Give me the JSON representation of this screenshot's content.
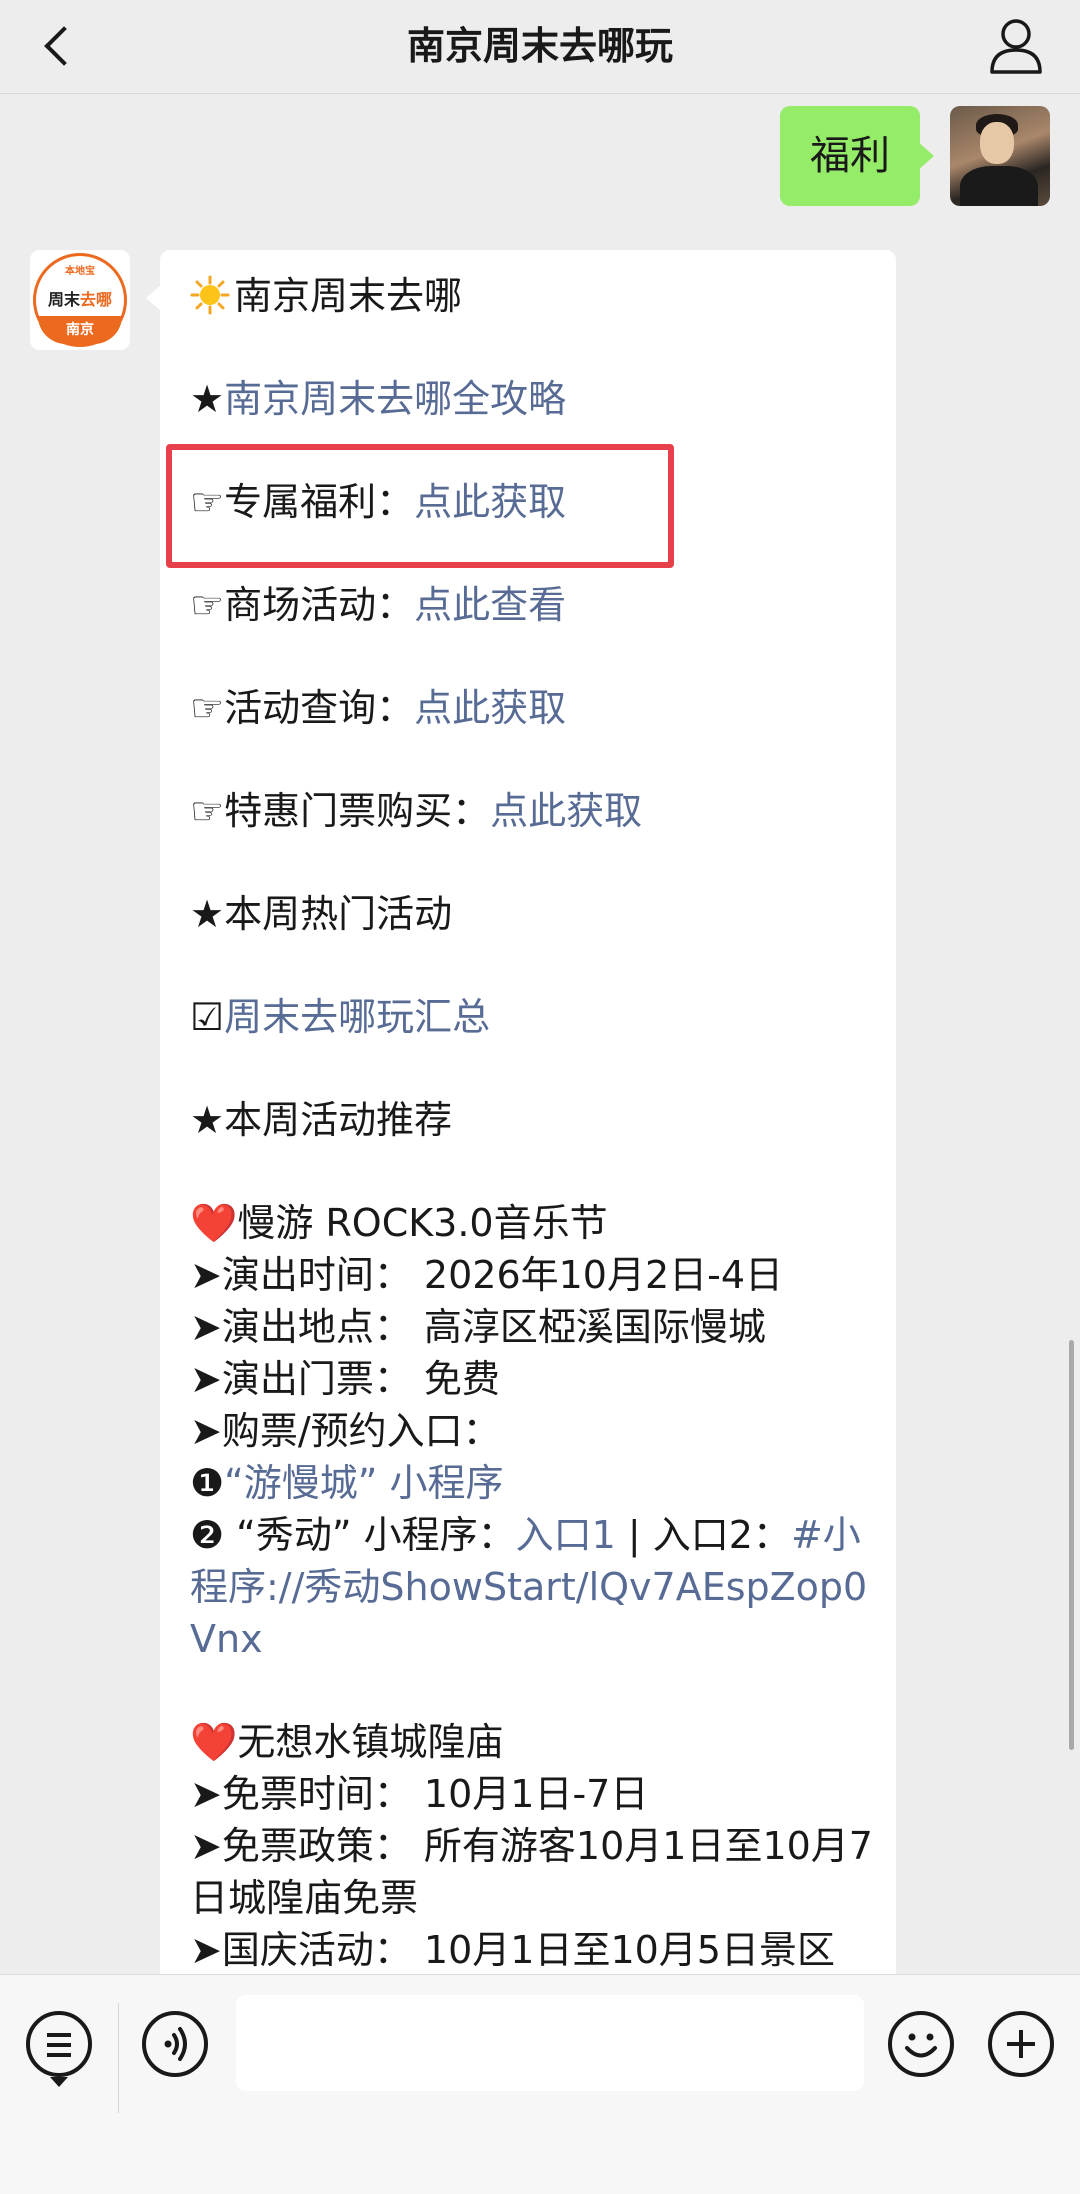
{
  "header": {
    "title": "南京周末去哪玩"
  },
  "outgoing": {
    "text": "福利"
  },
  "avatar_bot": {
    "top": "本地宝",
    "mid_a": "周末",
    "mid_b": "去哪",
    "bottom": "南京"
  },
  "message": {
    "brand": "南京周末去哪",
    "guide_star": "★",
    "guide_link": "南京周末去哪全攻略",
    "menu": [
      {
        "prefix": "☞专属福利：",
        "link": "点此获取"
      },
      {
        "prefix": "☞商场活动：",
        "link": "点此查看"
      },
      {
        "prefix": "☞活动查询：",
        "link": "点此获取"
      },
      {
        "prefix": "☞特惠门票购买：",
        "link": "点此获取"
      }
    ],
    "hot_title": "★本周热门活动",
    "summary_box": "☑",
    "summary_link": "周末去哪玩汇总",
    "rec_title": "★本周活动推荐",
    "event1": {
      "title": "❤️慢游 ROCK3.0音乐节",
      "time": "➤演出时间： 2026年10月2日-4日",
      "place": "➤演出地点： 高淳区椏溪国际慢城",
      "ticket": "➤演出门票： 免费",
      "entry": "➤购票/预约入口：",
      "mini1_num": "❶",
      "mini1_link": "“游慢城” 小程序",
      "mini2_prefix": "❷ “秀动” 小程序：",
      "mini2_link1": "入口1",
      "mini2_sep": " | 入口2：",
      "mini2_link2": "#小程序://秀动ShowStart/lQv7AEspZop0Vnx"
    },
    "event2": {
      "title": "❤️无想水镇城隍庙",
      "time": "➤免票时间： 10月1日-7日",
      "policy": "➤免票政策： 所有游客10月1日至10月7日城隍庙免票",
      "activity": "➤国庆活动： 10月1日至10月5日景区"
    }
  },
  "colors": {
    "link": "#576b95",
    "bubble_out": "#95ec69",
    "highlight": "#e8404a",
    "brand_orange": "#ec6a1f"
  },
  "icons": [
    "back-chevron-icon",
    "profile-icon",
    "menu-icon",
    "voice-icon",
    "emoji-icon",
    "plus-icon",
    "sun-icon"
  ]
}
